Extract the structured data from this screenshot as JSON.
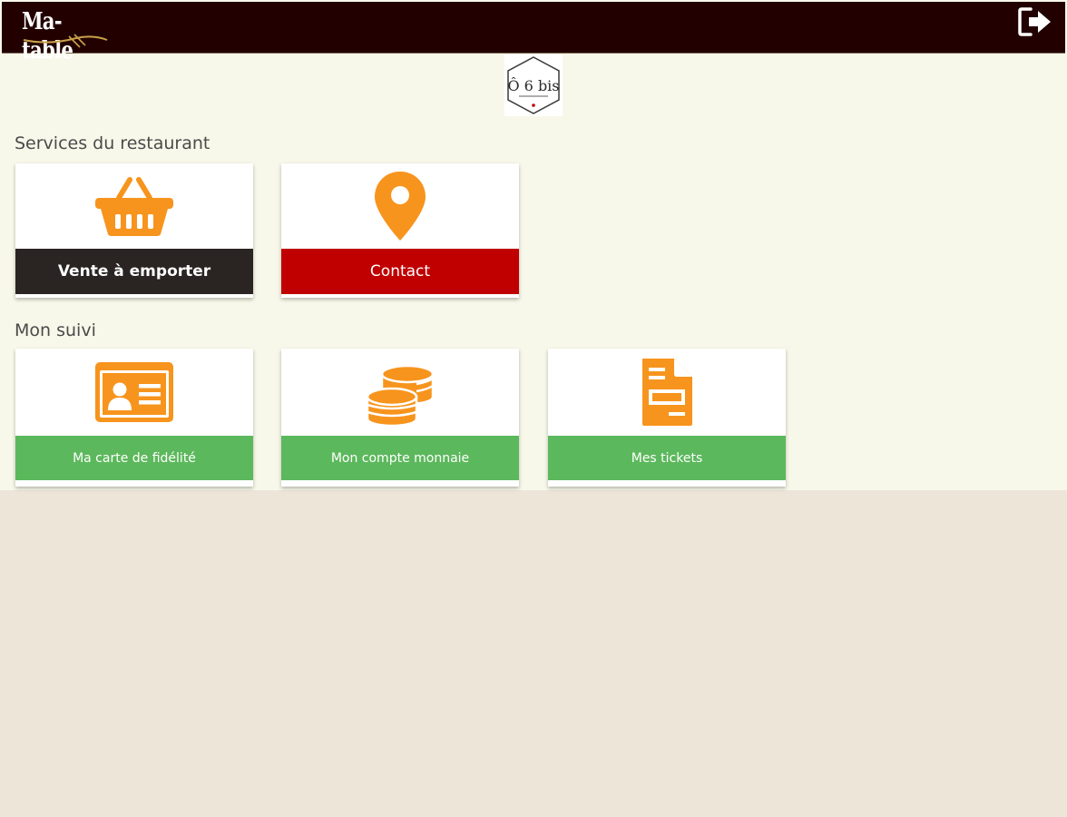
{
  "header": {
    "brand": "Ma-table",
    "logout_icon": "logout-icon"
  },
  "restaurant_logo": {
    "icon": "restaurant-logo",
    "text": "Ô 6 bis"
  },
  "sections": {
    "services": {
      "title": "Services du restaurant",
      "tiles": [
        {
          "label": "Vente à emporter",
          "icon": "basket-icon",
          "color": "#2a2422"
        },
        {
          "label": "Contact",
          "icon": "location-pin-icon",
          "color": "#c00000"
        }
      ]
    },
    "suivi": {
      "title": "Mon suivi",
      "tiles": [
        {
          "label": "Ma carte de fidélité",
          "icon": "id-card-icon",
          "color": "#5cb85c"
        },
        {
          "label": "Mon compte monnaie",
          "icon": "coins-icon",
          "color": "#5cb85c"
        },
        {
          "label": "Mes tickets",
          "icon": "ticket-document-icon",
          "color": "#5cb85c"
        }
      ]
    }
  },
  "colors": {
    "header_bg": "#220000",
    "accent_icon": "#f7941d",
    "page_bg": "#f8f8ea",
    "outer_bg": "#ede5d8"
  }
}
